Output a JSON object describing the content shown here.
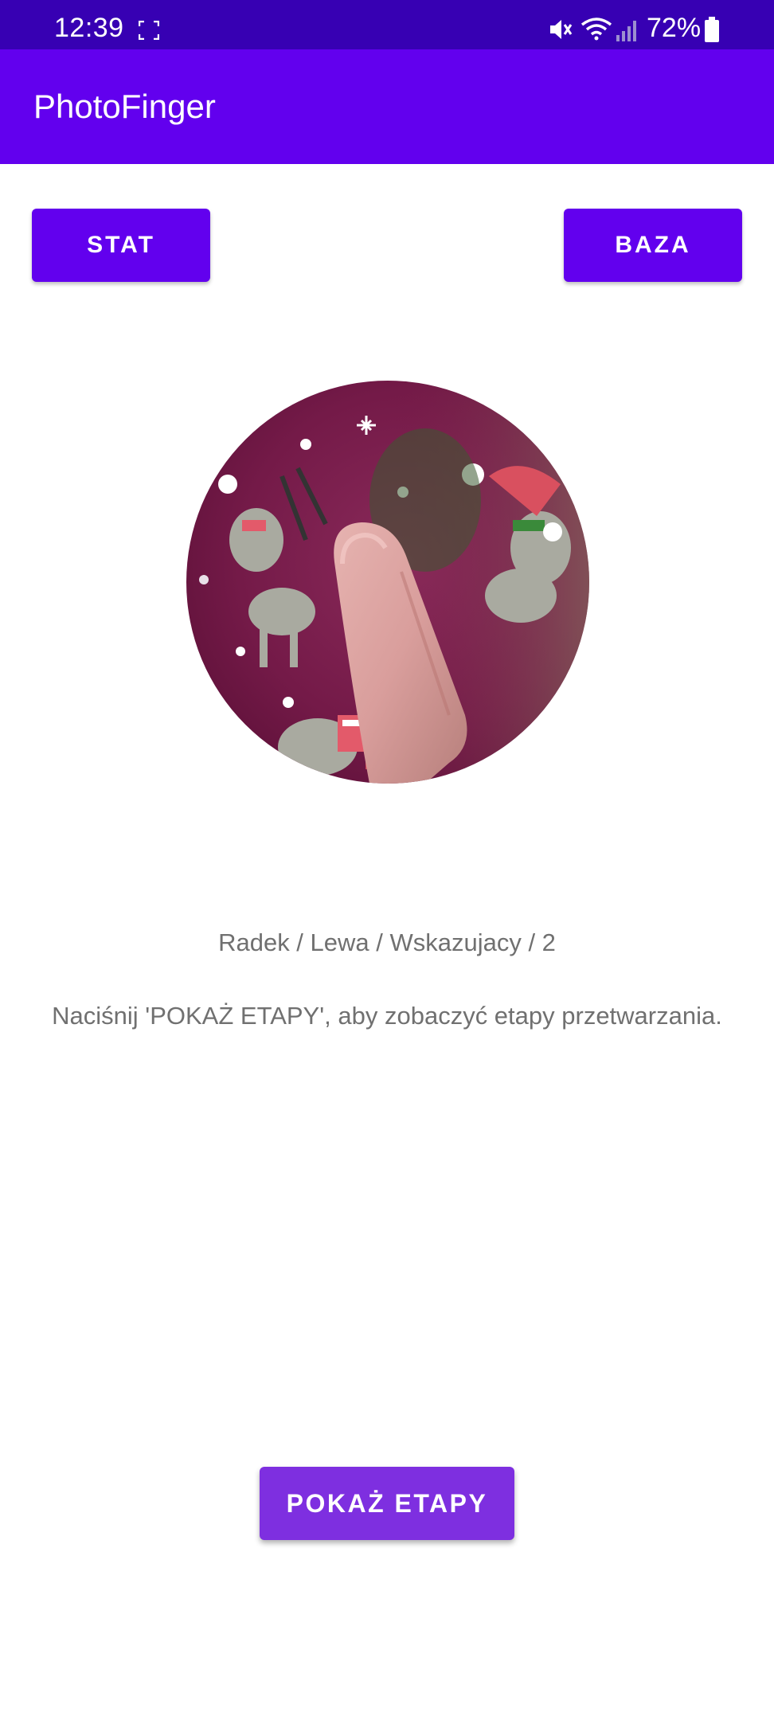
{
  "status_bar": {
    "time": "12:39",
    "battery_percent": "72%",
    "icons": [
      "screen-capture-icon",
      "mute-icon",
      "wifi-icon",
      "signal-icon",
      "battery-icon"
    ]
  },
  "app_bar": {
    "title": "PhotoFinger"
  },
  "toolbar": {
    "stat_label": "STAT",
    "baza_label": "BAZA"
  },
  "main": {
    "photo": "finger-photo",
    "person_info": "Radek / Lewa / Wskazujacy / 2",
    "hint": "Naciśnij 'POKAŻ ETAPY', aby zobaczyć etapy przetwarzania.",
    "show_stages_label": "POKAŻ ETAPY"
  },
  "colors": {
    "status_bar": "#3700b3",
    "primary": "#6200ee",
    "accent_button": "#7e2fe0",
    "photo_background": "#7a1c48"
  }
}
